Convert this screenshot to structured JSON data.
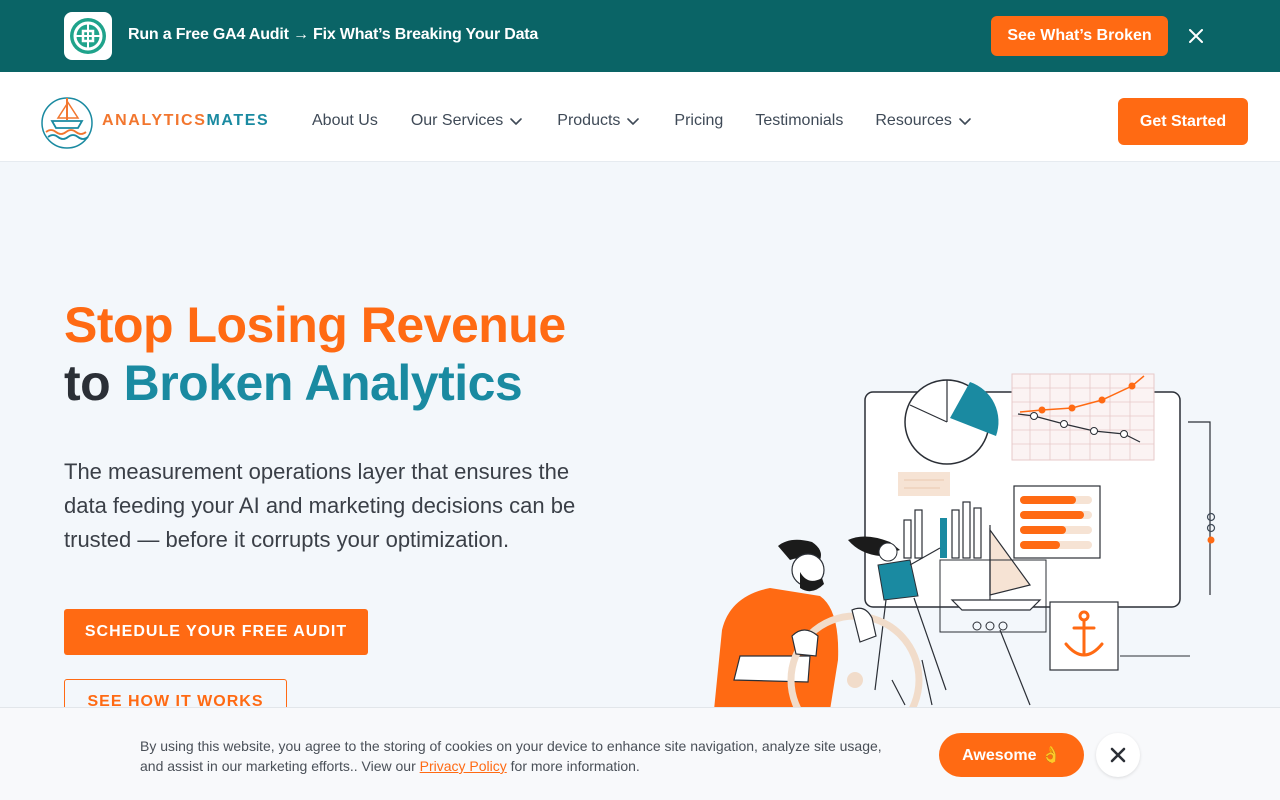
{
  "promo": {
    "text": "Run a Free GA4 Audit → Fix What’s Breaking Your Data",
    "button": "See What’s Broken",
    "close_icon": "close-icon"
  },
  "header": {
    "brand_part1": "ANALYTICS",
    "brand_part2": "MATES",
    "nav": [
      {
        "label": "About Us",
        "has_dropdown": false
      },
      {
        "label": "Our Services",
        "has_dropdown": true
      },
      {
        "label": "Products",
        "has_dropdown": true
      },
      {
        "label": "Pricing",
        "has_dropdown": false
      },
      {
        "label": "Testimonials",
        "has_dropdown": false
      },
      {
        "label": "Resources",
        "has_dropdown": true
      }
    ],
    "cta": "Get Started"
  },
  "hero": {
    "title_line1": "Stop Losing Revenue",
    "title_line2_a": "to",
    "title_line2_b": "Broken Analytics",
    "subtitle": "The measurement operations layer that ensures the data feeding your AI and marketing decisions can be trusted — before it corrupts your optimization.",
    "cta_primary": "SCHEDULE YOUR FREE AUDIT",
    "cta_secondary": "SEE HOW IT WORKS"
  },
  "cookie": {
    "text_before": "By using this website, you agree to the storing of cookies on your device to enhance site navigation, analyze site usage, and assist in our marketing efforts.. View our",
    "link": "Privacy Policy",
    "text_after": "for more information.",
    "button": "Awesome 👌"
  },
  "colors": {
    "accent": "#ff6a13",
    "teal": "#0a6466",
    "brand_teal": "#1a8aa1"
  }
}
